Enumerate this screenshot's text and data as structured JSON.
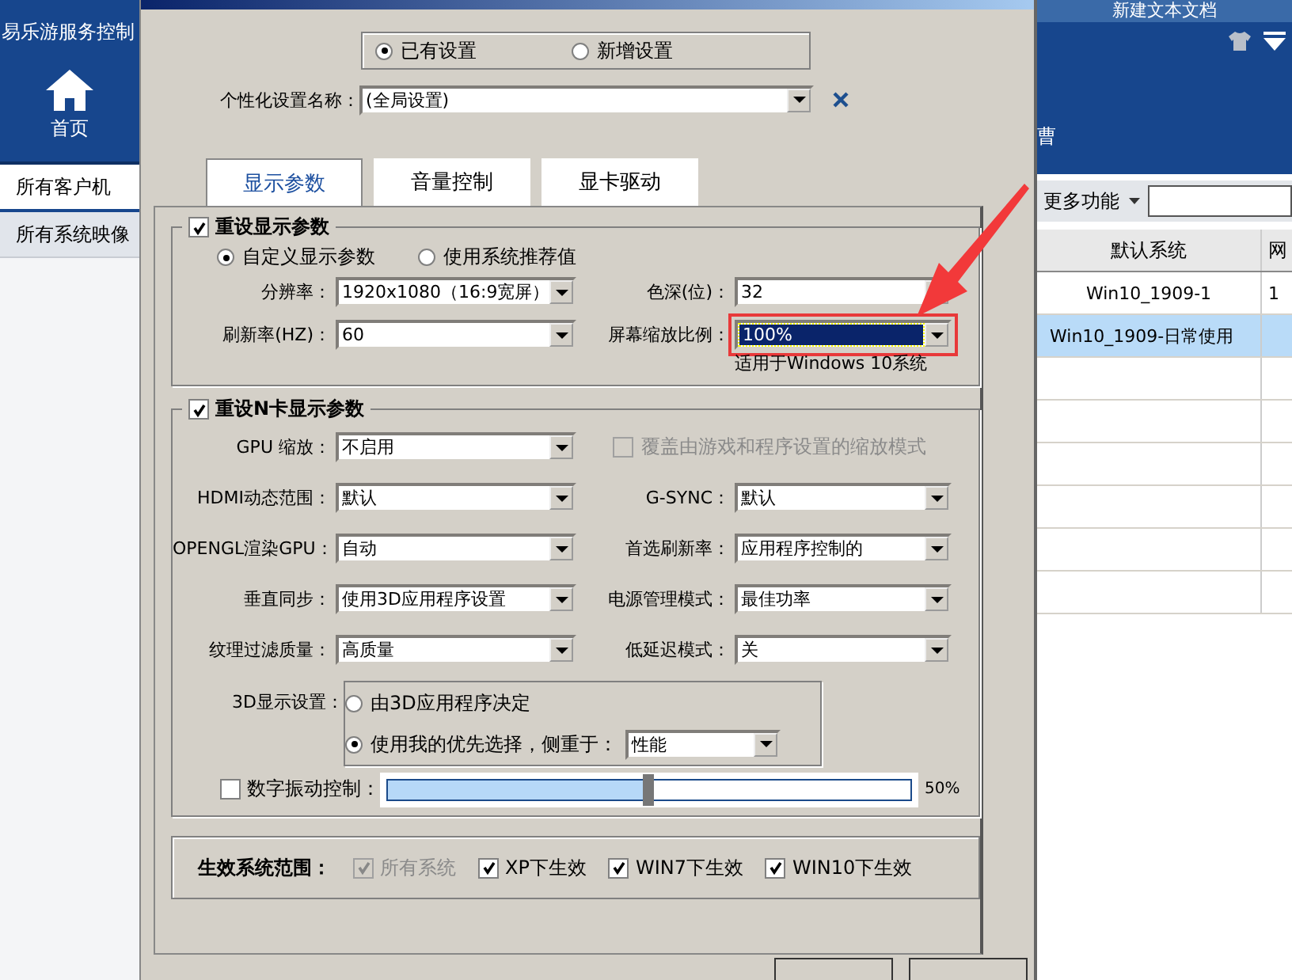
{
  "background": {
    "app_title": "易乐游服务控制",
    "home_label": "首页",
    "cut_label": "曹",
    "doc_title": "新建文本文档",
    "sidebar": [
      {
        "label": "所有客户机",
        "selected": true
      },
      {
        "label": "所有系统映像",
        "selected": false
      }
    ],
    "more_button": "更多功能",
    "table": {
      "columns": [
        "默认系统",
        "网"
      ],
      "rows": [
        {
          "cells": [
            "Win10_1909-1",
            "1"
          ],
          "selected": false
        },
        {
          "cells": [
            "Win10_1909-日常使用"
          ],
          "selected": true
        }
      ]
    }
  },
  "dialog": {
    "mode_options": [
      {
        "label": "已有设置",
        "selected": true
      },
      {
        "label": "新增设置",
        "selected": false
      }
    ],
    "name_label": "个性化设置名称：",
    "name_value": "(全局设置)",
    "tabs": [
      {
        "label": "显示参数",
        "selected": true
      },
      {
        "label": "音量控制",
        "selected": false
      },
      {
        "label": "显卡驱动",
        "selected": false
      }
    ],
    "display_group": {
      "label": "重设显示参数",
      "checked": true,
      "options": [
        {
          "label": "自定义显示参数",
          "selected": true
        },
        {
          "label": "使用系统推荐值",
          "selected": false
        }
      ],
      "fields": [
        {
          "label": "分辨率：",
          "value": "1920x1080（16:9宽屏）",
          "focused": false,
          "marked": false
        },
        {
          "label": "色深(位)：",
          "value": "32",
          "focused": false,
          "marked": false
        },
        {
          "label": "刷新率(HZ)：",
          "value": "60",
          "focused": false,
          "marked": false
        },
        {
          "label": "屏幕缩放比例：",
          "value": "100%",
          "focused": true,
          "marked": true
        }
      ],
      "note": "适用于Windows 10系统"
    },
    "nvidia_group": {
      "label": "重设N卡显示参数",
      "checked": true,
      "gpu_scaling": {
        "label": "GPU 缩放：",
        "value": "不启用"
      },
      "override": {
        "label": "覆盖由游戏和程序设置的缩放模式",
        "checked": false,
        "disabled": true
      },
      "fields": [
        {
          "label": "HDMI动态范围：",
          "value": "默认"
        },
        {
          "label": "G-SYNC：",
          "value": "默认"
        },
        {
          "label": "OPENGL渲染GPU：",
          "value": "自动"
        },
        {
          "label": "首选刷新率：",
          "value": "应用程序控制的"
        },
        {
          "label": "垂直同步：",
          "value": "使用3D应用程序设置"
        },
        {
          "label": "电源管理模式：",
          "value": "最佳功率"
        },
        {
          "label": "纹理过滤质量：",
          "value": "高质量"
        },
        {
          "label": "低延迟模式：",
          "value": "关"
        }
      ],
      "display_3d": {
        "label": "3D显示设置：",
        "options": [
          {
            "label": "由3D应用程序决定",
            "selected": false
          },
          {
            "label": "使用我的优先选择，侧重于：",
            "selected": true
          }
        ],
        "preference": "性能"
      },
      "vibrance": {
        "label": "数字振动控制：",
        "checked": false,
        "level": 0.5,
        "reading": "50%"
      }
    },
    "scope": {
      "label": "生效系统范围：",
      "options": [
        {
          "label": "所有系统",
          "checked": true,
          "disabled": true
        },
        {
          "label": "XP下生效",
          "checked": true,
          "disabled": false
        },
        {
          "label": "WIN7下生效",
          "checked": true,
          "disabled": false
        },
        {
          "label": "WIN10下生效",
          "checked": true,
          "disabled": false
        }
      ]
    }
  }
}
